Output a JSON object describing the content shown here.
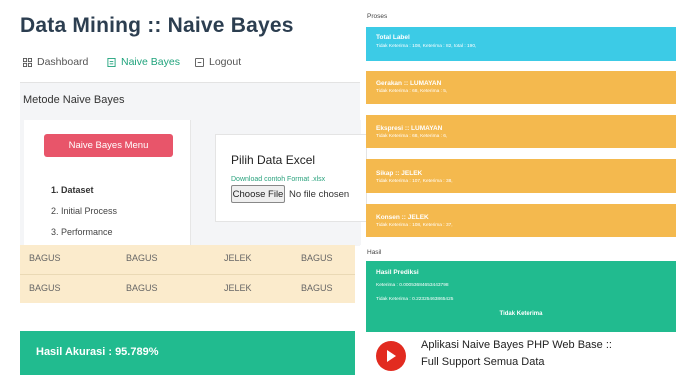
{
  "header": {
    "title": "Data Mining :: Naive Bayes"
  },
  "nav": [
    {
      "label": "Dashboard",
      "icon": "grid-icon"
    },
    {
      "label": "Naive Bayes",
      "icon": "document-icon"
    },
    {
      "label": "Logout",
      "icon": "logout-icon"
    }
  ],
  "panel": {
    "title": "Metode Naive Bayes"
  },
  "menu": {
    "button": "Naive Bayes Menu",
    "steps": [
      "1. Dataset",
      "2. Initial Process",
      "3. Performance"
    ]
  },
  "excel": {
    "title": "Pilih Data Excel",
    "link": "Download contoh Format .xlsx",
    "choose": "Choose File",
    "no_file": "No file chosen"
  },
  "table": {
    "rows": [
      [
        "BAGUS",
        "BAGUS",
        "JELEK",
        "BAGUS"
      ],
      [
        "BAGUS",
        "BAGUS",
        "JELEK",
        "BAGUS"
      ]
    ]
  },
  "accuracy": {
    "text": "Hasil Akurasi : 95.789%"
  },
  "proses": {
    "label": "Proses",
    "cards": [
      {
        "title": "Total Label",
        "detail": "Tidak Keterima : 108, Keterima : 82, total : 190,"
      },
      {
        "title": "Gerakan :: LUMAYAN",
        "detail": "Tidak Keterima : 68, Keterima : 5,"
      },
      {
        "title": "Ekspresi :: LUMAYAN",
        "detail": "Tidak Keterima : 68, Keterima : 6,"
      },
      {
        "title": "Sikap :: JELEK",
        "detail": "Tidak Keterima : 107, Keterima : 38,"
      },
      {
        "title": "Konsen :: JELEK",
        "detail": "Tidak Keterima : 108, Keterima : 37,"
      }
    ],
    "colors": {
      "total": "#3ccbe6",
      "attribute": "#f4b94e"
    }
  },
  "hasil": {
    "label": "Hasil",
    "title": "Hasil Prediksi",
    "keterima": "Keterima : 0.00053684653443798",
    "tidak": "Tidak Keterima : 0.22325463865425",
    "result": "Tidak Keterima",
    "color": "#21bb8f"
  },
  "promo": {
    "icon": "youtube-icon",
    "line1": "Aplikasi Naive Bayes PHP Web Base ::",
    "line2": "Full Support Semua Data"
  }
}
